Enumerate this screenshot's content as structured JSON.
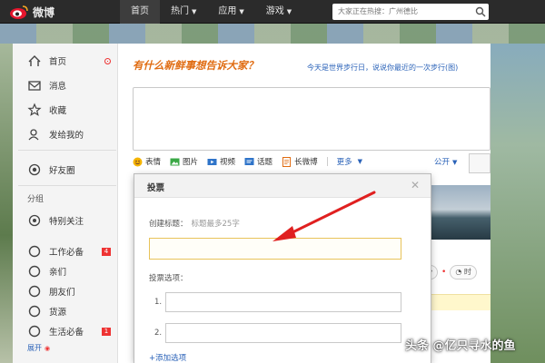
{
  "topbar": {
    "logo_text": "微博",
    "nav": [
      {
        "label": "首页",
        "caret": false,
        "active": true
      },
      {
        "label": "热门",
        "caret": true,
        "active": false
      },
      {
        "label": "应用",
        "caret": true,
        "active": false
      },
      {
        "label": "游戏",
        "caret": true,
        "active": false
      }
    ],
    "search_placeholder": "大家正在热搜：广州德比"
  },
  "sidebar": {
    "items": [
      {
        "label": "首页",
        "icon": "home-icon"
      },
      {
        "label": "消息",
        "icon": "mail-icon"
      },
      {
        "label": "收藏",
        "icon": "star-icon"
      },
      {
        "label": "发给我的",
        "icon": "person-icon"
      },
      {
        "label": "好友圈",
        "icon": "circle-dot-icon"
      }
    ],
    "group_header": "分组",
    "groups": [
      {
        "label": "特别关注",
        "icon": "target-icon",
        "badge": ""
      },
      {
        "label": "工作必备",
        "icon": "circle-icon",
        "badge": "4"
      },
      {
        "label": "亲们",
        "icon": "circle-icon",
        "badge": ""
      },
      {
        "label": "朋友们",
        "icon": "circle-icon",
        "badge": ""
      },
      {
        "label": "货源",
        "icon": "circle-icon",
        "badge": ""
      },
      {
        "label": "生活必备",
        "icon": "circle-icon",
        "badge": "1"
      }
    ],
    "expand_label": "展开"
  },
  "composer": {
    "prompt": "有什么新鲜事想告诉大家？",
    "tip": "今天是世界步行日，说说你最近的一次步行(图)",
    "tools": [
      {
        "label": "表情",
        "icon": "emoji-icon"
      },
      {
        "label": "图片",
        "icon": "image-icon"
      },
      {
        "label": "视频",
        "icon": "video-icon"
      },
      {
        "label": "话题",
        "icon": "topic-icon"
      },
      {
        "label": "长微博",
        "icon": "long-post-icon"
      }
    ],
    "more_label": "更多",
    "visibility_label": "公开"
  },
  "feed": {
    "filter_time_label": "时"
  },
  "vote_dialog": {
    "title": "投票",
    "create_title_label": "创建标题：",
    "create_title_hint": "标题最多25字",
    "options_label": "投票选项：",
    "option_numbers": [
      "1.",
      "2."
    ],
    "add_option_label": "+添加选项"
  },
  "watermark": "头条 @亿只寻水的鱼",
  "colors": {
    "accent_orange": "#e06c12",
    "link_blue": "#2a62b8",
    "badge_red": "#e33333",
    "arrow_red": "#e02020"
  }
}
